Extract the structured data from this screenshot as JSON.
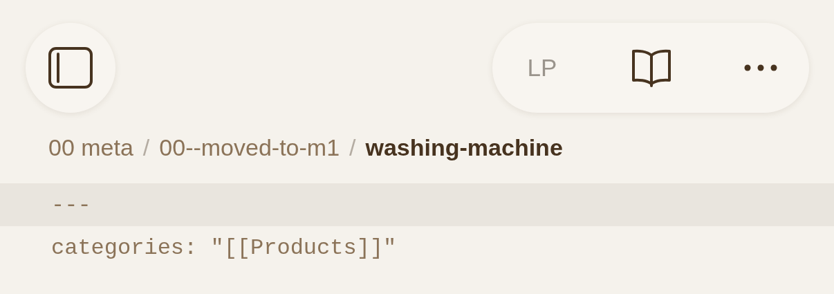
{
  "toolbar": {
    "mode_label": "LP"
  },
  "breadcrumb": [
    {
      "label": "00 meta",
      "current": false
    },
    {
      "label": "00--moved-to-m1",
      "current": false
    },
    {
      "label": "washing-machine",
      "current": true
    }
  ],
  "separator": "/",
  "editor": {
    "lines": [
      {
        "text": "---",
        "active": true
      },
      {
        "text": "categories: \"[[Products]]\"",
        "active": false
      }
    ]
  }
}
